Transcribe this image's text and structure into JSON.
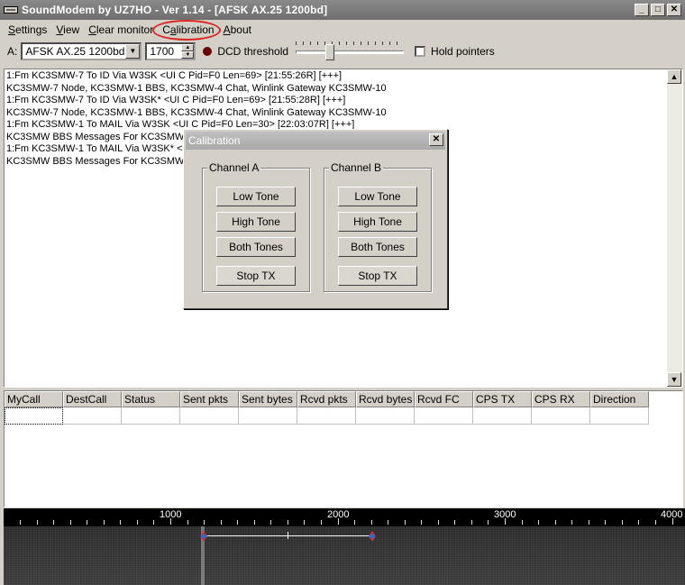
{
  "window": {
    "title": "SoundModem by UZ7HO - Ver 1.14 - [AFSK AX.25 1200bd]"
  },
  "menu": {
    "items": [
      {
        "pre": "",
        "u": "S",
        "post": "ettings"
      },
      {
        "pre": "",
        "u": "V",
        "post": "iew"
      },
      {
        "pre": "",
        "u": "C",
        "post": "lear monitor"
      },
      {
        "pre": "C",
        "u": "a",
        "post": "libration"
      },
      {
        "pre": "",
        "u": "A",
        "post": "bout"
      }
    ]
  },
  "toolbar": {
    "channel_label": "A:",
    "mode_value": "AFSK AX.25 1200bd",
    "freq_value": "1700",
    "dcd_label": "DCD threshold",
    "dcd_threshold": 0.3,
    "hold_pointers_label": "Hold pointers",
    "hold_pointers_checked": false
  },
  "monitor": {
    "lines": [
      "1:Fm KC3SMW-7 To ID Via W3SK <UI C Pid=F0 Len=69> [21:55:26R] [+++]",
      "KC3SMW-7 Node, KC3SMW-1 BBS, KC3SMW-4 Chat, Winlink Gateway KC3SMW-10",
      "1:Fm KC3SMW-7 To ID Via W3SK* <UI C Pid=F0 Len=69> [21:55:28R] [+++]",
      "KC3SMW-7 Node, KC3SMW-1 BBS, KC3SMW-4 Chat, Winlink Gateway KC3SMW-10",
      "1:Fm KC3SMW-1 To MAIL Via W3SK <UI C Pid=F0 Len=30> [22:03:07R] [+++]",
      "KC3SMW BBS Messages For KC3SMW",
      "1:Fm KC3SMW-1 To MAIL Via W3SK* <UI",
      "KC3SMW BBS Messages For KC3SMW"
    ]
  },
  "table": {
    "columns": [
      "MyCall",
      "DestCall",
      "Status",
      "Sent pkts",
      "Sent bytes",
      "Rcvd pkts",
      "Rcvd bytes",
      "Rcvd FC",
      "CPS TX",
      "CPS RX",
      "Direction"
    ]
  },
  "waterfall": {
    "tick_labels": [
      "1000",
      "2000",
      "3000",
      "4000"
    ],
    "marker_low_hz": 1200,
    "marker_high_hz": 2200
  },
  "dialog": {
    "title": "Calibration",
    "channel_a": {
      "label": "Channel A",
      "low": "Low Tone",
      "high": "High Tone",
      "both": "Both Tones",
      "stop": "Stop TX"
    },
    "channel_b": {
      "label": "Channel B",
      "low": "Low Tone",
      "high": "High Tone",
      "both": "Both Tones",
      "stop": "Stop TX"
    }
  }
}
